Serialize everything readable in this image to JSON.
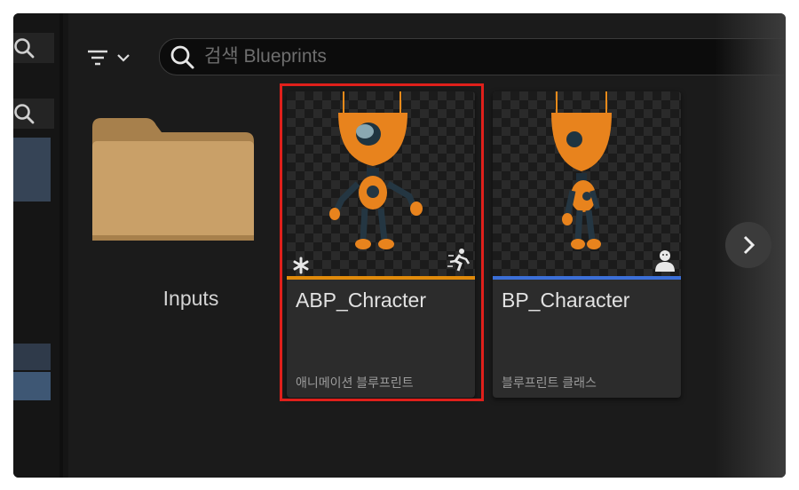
{
  "search": {
    "placeholder": "검색 Blueprints",
    "value": ""
  },
  "toolbar": {
    "filter_icon": "filter-icon",
    "dropdown_icon": "chevron-down-icon"
  },
  "folders": [
    {
      "label": "Inputs",
      "icon": "folder-icon"
    }
  ],
  "assets": [
    {
      "name": "ABP_Chracter",
      "type": "애니메이션 블루프린트",
      "accent_color": "#e08a0b",
      "badge_icon": "animation-running-icon",
      "selected": true
    },
    {
      "name": "BP_Character",
      "type": "블루프린트 클래스",
      "accent_color": "#3b6fd8",
      "badge_icon": "character-icon",
      "selected": false
    }
  ],
  "navigation": {
    "next_icon": "chevron-right-icon"
  },
  "colors": {
    "selection_border": "#e0201b",
    "folder": "#c9a068"
  }
}
